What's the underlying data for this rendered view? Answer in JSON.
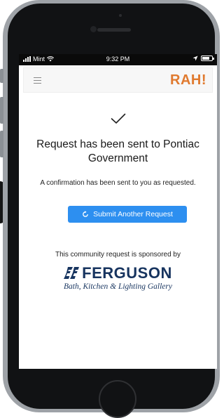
{
  "status_bar": {
    "carrier": "Mint",
    "time": "9:32 PM",
    "battery_level": 0.75
  },
  "header": {
    "logo_text": "RAH!",
    "menu_icon": "hamburger-icon",
    "brand_color": "#e07a2f"
  },
  "main": {
    "success_icon": "checkmark-icon",
    "title": "Request has been sent to Pontiac Government",
    "confirmation": "A confirmation has been sent to you as requested.",
    "submit_again_label": "Submit Another Request",
    "submit_again_icon": "refresh-icon",
    "button_color": "#2d8ff0"
  },
  "sponsor": {
    "text": "This community request is sponsored by",
    "brand_name": "FERGUSON",
    "brand_tagline": "Bath, Kitchen & Lighting Gallery",
    "brand_color": "#17345f"
  }
}
